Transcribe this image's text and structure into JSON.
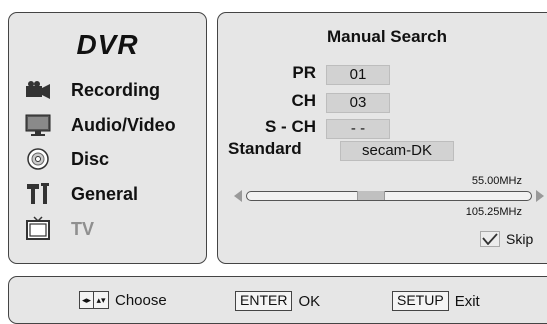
{
  "menu": {
    "title": "DVR",
    "items": [
      {
        "label": "Recording",
        "icon": "camcorder-icon"
      },
      {
        "label": "Audio/Video",
        "icon": "monitor-icon"
      },
      {
        "label": "Disc",
        "icon": "disc-icon"
      },
      {
        "label": "General",
        "icon": "tools-icon"
      },
      {
        "label": "TV",
        "icon": "tv-icon",
        "state": "disabled"
      }
    ]
  },
  "manual_search": {
    "title": "Manual Search",
    "fields": {
      "pr": {
        "label": "PR",
        "value": "01"
      },
      "ch": {
        "label": "CH",
        "value": "03"
      },
      "sch": {
        "label": "S - CH",
        "value": "- -"
      },
      "standard": {
        "label": "Standard",
        "value": "secam-DK"
      }
    },
    "freq_top": "55.00MHz",
    "freq_bottom": "105.25MHz",
    "skip_label": "Skip"
  },
  "footer": {
    "choose_label": "Choose",
    "enter_key": "ENTER",
    "enter_label": "OK",
    "setup_key": "SETUP",
    "setup_label": "Exit"
  },
  "colors": {
    "panel_bg": "#e6e6e6",
    "border": "#444444",
    "disabled_text": "#8f8f8f"
  }
}
